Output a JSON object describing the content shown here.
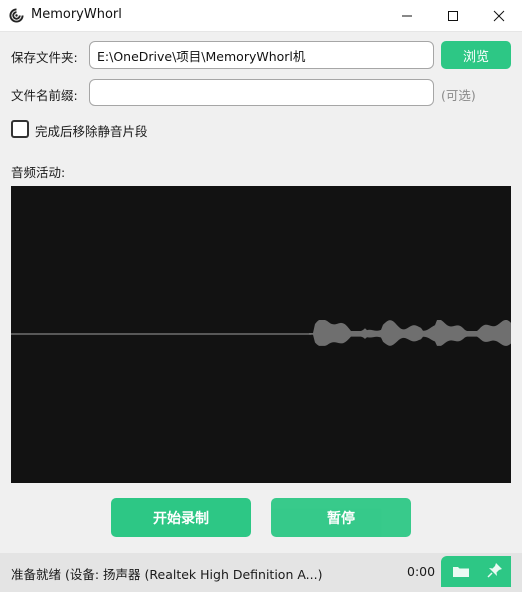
{
  "window": {
    "title": "MemoryWhorl"
  },
  "form": {
    "save_folder_label": "保存文件夹:",
    "save_folder_value": "E:\\OneDrive\\项目\\MemoryWhorl机",
    "browse_button": "浏览",
    "prefix_label": "文件名前缀:",
    "prefix_value": "",
    "prefix_hint": "(可选)",
    "remove_silence_label": "完成后移除静音片段",
    "remove_silence_checked": false
  },
  "audio": {
    "activity_label": "音频活动:"
  },
  "controls": {
    "start_button": "开始录制",
    "pause_button": "暂停"
  },
  "status": {
    "text": "准备就绪 (设备: 扬声器 (Realtek High Definition A...)",
    "time": "0:00"
  },
  "icons": {
    "folder": "folder-icon",
    "pin": "pin-icon"
  },
  "colors": {
    "accent": "#2dc785",
    "waveform_bg": "#121212",
    "waveform": "#6f6f6f"
  }
}
